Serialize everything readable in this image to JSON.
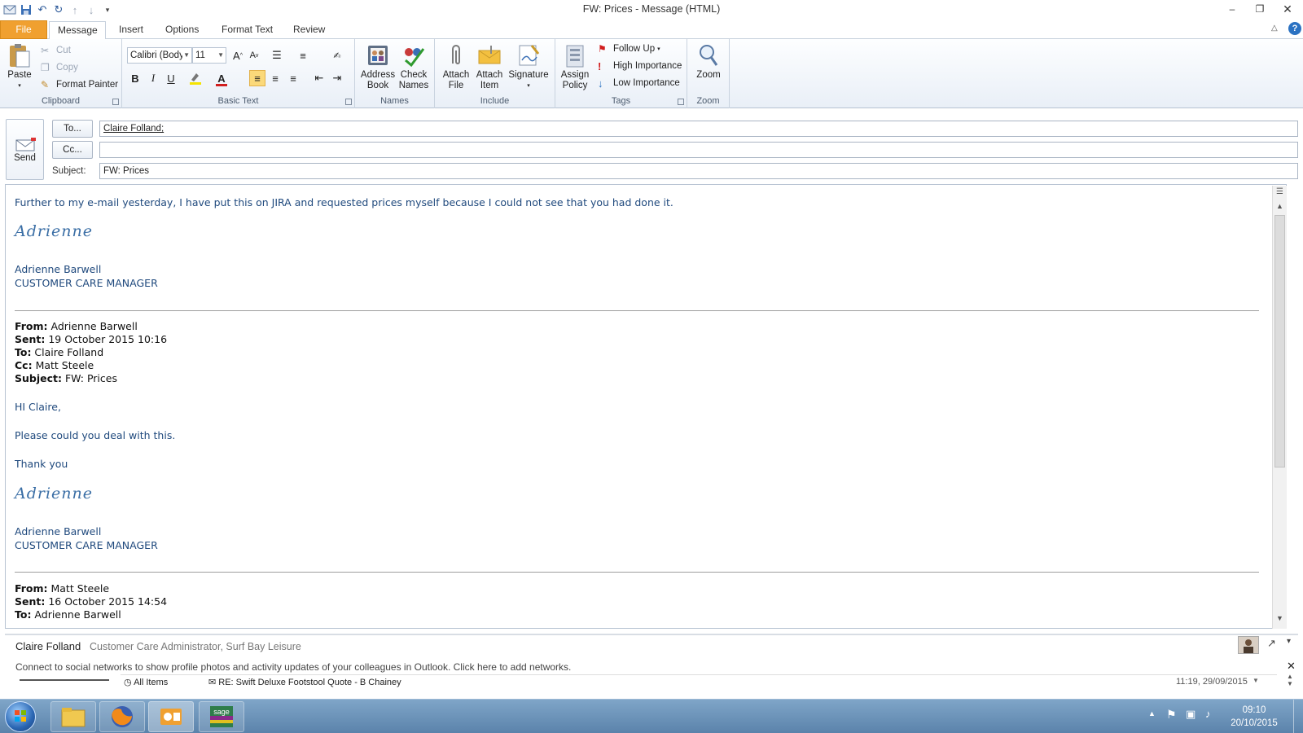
{
  "window": {
    "title": "FW: Prices  -  Message (HTML)",
    "quick_access": [
      "save-icon",
      "undo-icon",
      "redo-icon",
      "up-arrow-icon",
      "down-arrow-icon",
      "customize-icon"
    ]
  },
  "tabs": [
    {
      "label": "File"
    },
    {
      "label": "Message"
    },
    {
      "label": "Insert"
    },
    {
      "label": "Options"
    },
    {
      "label": "Format Text"
    },
    {
      "label": "Review"
    }
  ],
  "ribbon": {
    "clipboard": {
      "label": "Clipboard",
      "paste": "Paste",
      "cut": "Cut",
      "copy": "Copy",
      "format_painter": "Format Painter"
    },
    "basic_text": {
      "label": "Basic Text",
      "font": "Calibri (Body)",
      "size": "11"
    },
    "names": {
      "label": "Names",
      "address_book": "Address\nBook",
      "address_book_l1": "Address",
      "address_book_l2": "Book",
      "check_names_l1": "Check",
      "check_names_l2": "Names"
    },
    "include": {
      "label": "Include",
      "attach_file_l1": "Attach",
      "attach_file_l2": "File",
      "attach_item_l1": "Attach",
      "attach_item_l2": "Item",
      "signature": "Signature"
    },
    "tags": {
      "label": "Tags",
      "assign_policy_l1": "Assign",
      "assign_policy_l2": "Policy",
      "follow_up": "Follow Up",
      "high_importance": "High Importance",
      "low_importance": "Low Importance"
    },
    "zoom": {
      "label": "Zoom",
      "zoom": "Zoom"
    }
  },
  "header": {
    "send": "Send",
    "to_button": "To...",
    "cc_button": "Cc...",
    "subject_label": "Subject:",
    "to_value": "Claire Folland;",
    "cc_value": "",
    "subject_value": "FW: Prices"
  },
  "body": {
    "intro": "Further to my e-mail yesterday, I have put this on JIRA and requested prices myself because I could not see that you had done it.",
    "signature_script": "Adrienne",
    "sig_name": "Adrienne Barwell",
    "sig_title": "CUSTOMER CARE MANAGER",
    "fwd1": {
      "from_label": "From:",
      "from": " Adrienne Barwell",
      "sent_label": "Sent:",
      "sent": " 19 October 2015 10:16",
      "to_label": "To:",
      "to": " Claire Folland",
      "cc_label": "Cc:",
      "cc": " Matt Steele",
      "subject_label": "Subject:",
      "subject": " FW: Prices"
    },
    "greeting": "HI Claire,",
    "request": "Please could you deal with this.",
    "thanks": "Thank you",
    "fwd2": {
      "from_label": "From:",
      "from": " Matt Steele",
      "sent_label": "Sent:",
      "sent": " 16 October 2015 14:54",
      "to_label": "To:",
      "to": " Adrienne Barwell"
    }
  },
  "people_pane": {
    "name": "Claire Folland",
    "detail": "Customer Care Administrator, Surf Bay Leisure",
    "social_message": "Connect to social networks to show profile photos and activity updates of your colleagues in Outlook. Click here to add networks.",
    "activity_filter": "All Items",
    "activity_item": "RE: Swift Deluxe Footstool Quote - B Chainey",
    "activity_date": "11:19, 29/09/2015"
  },
  "taskbar": {
    "time": "09:10",
    "date": "20/10/2015",
    "apps": [
      "windows-start-icon",
      "file-explorer-icon",
      "firefox-icon",
      "outlook-icon",
      "sage-icon"
    ]
  },
  "colors": {
    "file_tab": "#f0a030",
    "body_text": "#1f497d",
    "signature": "#3a6ea5"
  }
}
